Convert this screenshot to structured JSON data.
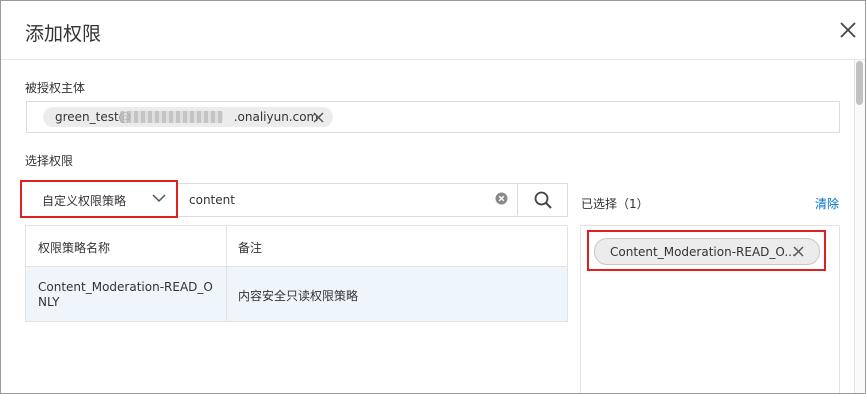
{
  "dialog": {
    "title": "添加权限",
    "close_icon": "close-icon"
  },
  "principal": {
    "label": "被授权主体",
    "tag_prefix": "green_test@",
    "tag_suffix": ".onaliyun.com",
    "tag_close_icon": "close-icon"
  },
  "permissions": {
    "label": "选择权限",
    "policy_type": "自定义权限策略",
    "search_value": "content",
    "clear_icon": "clear-circle-icon",
    "search_icon": "search-icon",
    "table": {
      "columns": [
        "权限策略名称",
        "备注"
      ],
      "rows": [
        {
          "name": "Content_Moderation-READ_ONLY",
          "note": "内容安全只读权限策略"
        }
      ]
    }
  },
  "selected": {
    "title": "已选择（1）",
    "clear_label": "清除",
    "items": [
      {
        "label": "Content_Moderation-READ_O..."
      }
    ]
  },
  "colors": {
    "highlight": "#e02020",
    "link": "#0070cc",
    "row_selected": "#eef6fc"
  }
}
